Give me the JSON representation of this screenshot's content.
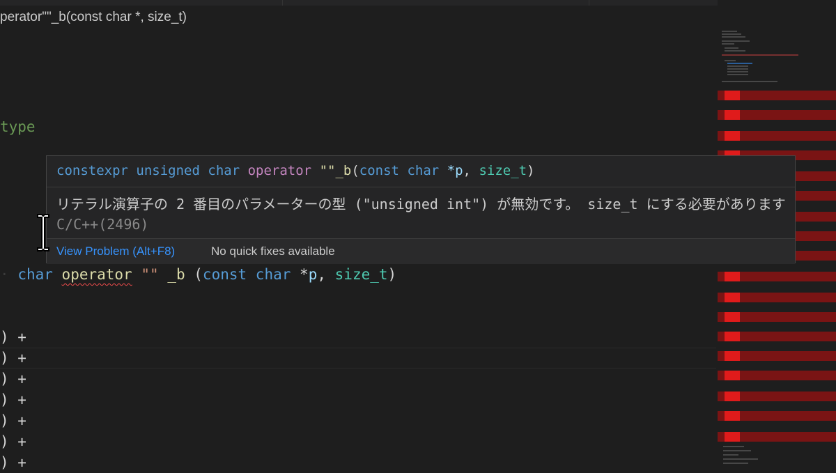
{
  "breadcrumb": {
    "text": "perator\"\"_b(const char *, size_t)"
  },
  "editor": {
    "comment_fragment": "type",
    "code_line": {
      "kw_char": "char",
      "kw_operator": "operator",
      "str_literal": "\"\"",
      "suffix": "_b",
      "open": "(",
      "kw_const": "const",
      "kw_char2": "char",
      "star": "*",
      "param_p": "p",
      "comma": ",",
      "type_size_t": "size_t",
      "close": ")"
    },
    "plus_lines": [
      ") +",
      ") +",
      ") +",
      ") +",
      ") +",
      ") +",
      ") +"
    ]
  },
  "hover": {
    "signature": {
      "constexpr": "constexpr",
      "unsigned": "unsigned",
      "char": "char",
      "operator": "operator",
      "literal": "\"\"_b",
      "open": "(",
      "const": "const",
      "char2": "char",
      "star_p": "*p",
      "comma": ",",
      "size_t": "size_t",
      "close": ")"
    },
    "message": "リテラル演算子の 2 番目のパラメーターの型 (\"unsigned int\") が無効です。 size_t にする必要があります",
    "source": "C/C++(2496)",
    "view_problem": "View Problem (Alt+F8)",
    "no_fixes": "No quick fixes available"
  },
  "colors": {
    "background": "#1e1e1e",
    "keyword": "#569cd6",
    "string": "#ce9178",
    "link": "#3794ff",
    "error": "#f14c4c",
    "minimap_error": "#7a1414"
  },
  "icons": [
    "text-cursor-icon"
  ]
}
